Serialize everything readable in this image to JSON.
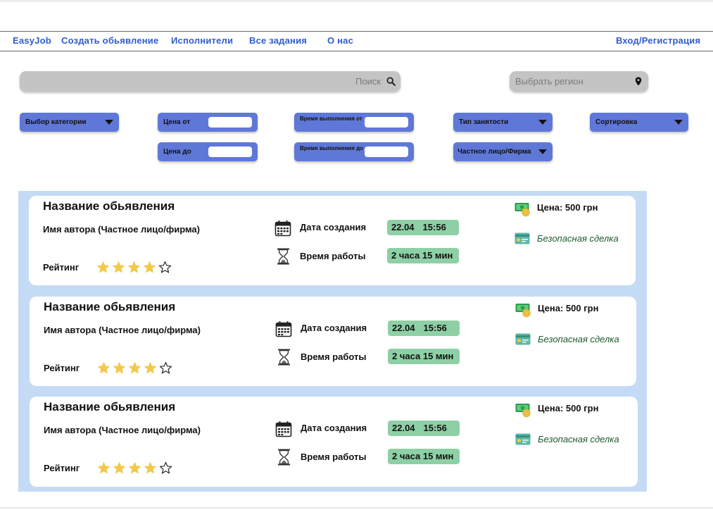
{
  "nav": {
    "items": [
      {
        "label": "EasyJob"
      },
      {
        "label": "Создать обьявление"
      },
      {
        "label": "Исполнители"
      },
      {
        "label": "Все задания"
      },
      {
        "label": "О нас"
      }
    ],
    "login": "Вход/Регистрация",
    "link_color": "#2f5dcc"
  },
  "search": {
    "placeholder": "Поиск",
    "value": "",
    "icon": "search-icon"
  },
  "region": {
    "placeholder": "Выбрать регион",
    "value": "",
    "icon": "location-pin-icon"
  },
  "filters": {
    "category": "Выбор категории",
    "price_from": "Цена от",
    "price_to": "Цена до",
    "time_from": "Время выполнения от",
    "time_to": "Время выполнения до",
    "employment": "Тип занятости",
    "person_type": "Частное лицо/Фирма",
    "sort": "Сортировка",
    "accent_color": "#5f78d8"
  },
  "listings": [
    {
      "title": "Название обьявления",
      "author": "Имя автора (Частное лицо/фирма)",
      "rating_label": "Рейтинг",
      "rating": 4,
      "rating_max": 5,
      "created_label": "Дата создания",
      "created_date": "22.04",
      "created_time": "15:56",
      "work_label": "Время работы",
      "work_time": "2 часа 15 мин",
      "price": "Цена: 500 грн",
      "safe_deal": "Безопасная сделка"
    },
    {
      "title": "Название обьявления",
      "author": "Имя автора (Частное лицо/фирма)",
      "rating_label": "Рейтинг",
      "rating": 4,
      "rating_max": 5,
      "created_label": "Дата создания",
      "created_date": "22.04",
      "created_time": "15:56",
      "work_label": "Время работы",
      "work_time": "2 часа 15 мин",
      "price": "Цена: 500 грн",
      "safe_deal": "Безопасная сделка"
    },
    {
      "title": "Название обьявления",
      "author": "Имя автора (Частное лицо/фирма)",
      "rating_label": "Рейтинг",
      "rating": 4,
      "rating_max": 5,
      "created_label": "Дата создания",
      "created_date": "22.04",
      "created_time": "15:56",
      "work_label": "Время работы",
      "work_time": "2 часа 15 мин",
      "price": "Цена: 500 грн",
      "safe_deal": "Безопасная сделка"
    }
  ],
  "colors": {
    "list_bg": "#c5dbf5",
    "pill": "#8ed0a5",
    "star": "#f2c94c",
    "safe_text": "#1f5a2e"
  }
}
